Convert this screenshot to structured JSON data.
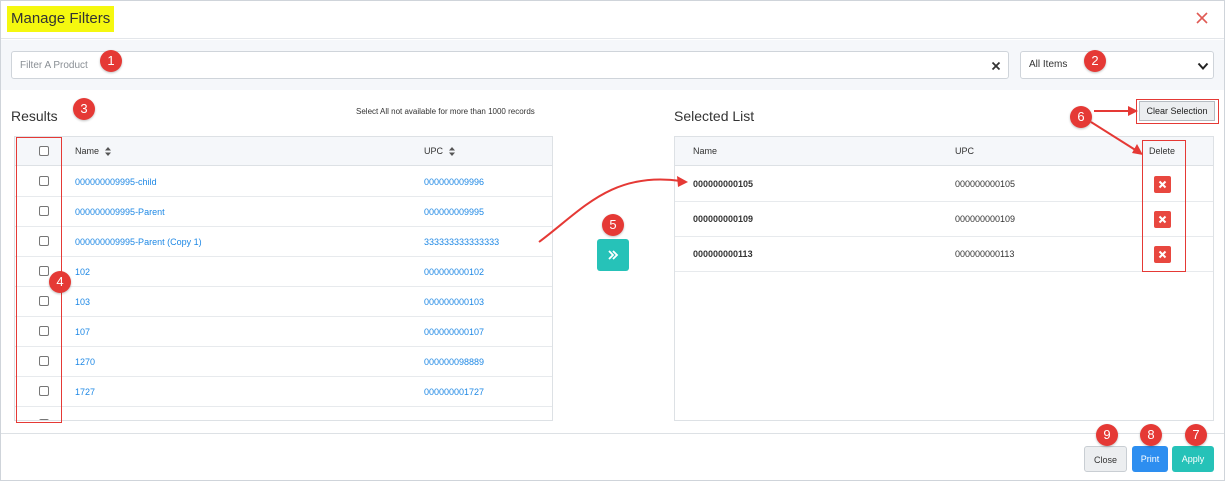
{
  "modal": {
    "title": "Manage Filters"
  },
  "search": {
    "placeholder": "Filter A Product",
    "value": ""
  },
  "filter_select": {
    "selected": "All Items"
  },
  "results": {
    "title": "Results",
    "note": "Select All not available for more than 1000 records",
    "columns": {
      "name": "Name",
      "upc": "UPC"
    },
    "rows": [
      {
        "name": "000000009995-child",
        "upc": "000000009996"
      },
      {
        "name": "000000009995-Parent",
        "upc": "000000009995"
      },
      {
        "name": "000000009995-Parent (Copy 1)",
        "upc": "333333333333333"
      },
      {
        "name": "102",
        "upc": "000000000102"
      },
      {
        "name": "103",
        "upc": "000000000103"
      },
      {
        "name": "107",
        "upc": "000000000107"
      },
      {
        "name": "1270",
        "upc": "000000098889"
      },
      {
        "name": "1727",
        "upc": "000000001727"
      }
    ]
  },
  "selected": {
    "title": "Selected List",
    "clear_label": "Clear Selection",
    "columns": {
      "name": "Name",
      "upc": "UPC",
      "delete": "Delete"
    },
    "rows": [
      {
        "name": "000000000105",
        "upc": "000000000105"
      },
      {
        "name": "000000000109",
        "upc": "000000000109"
      },
      {
        "name": "000000000113",
        "upc": "000000000113"
      }
    ]
  },
  "footer": {
    "close_label": "Close",
    "print_label": "Print",
    "apply_label": "Apply"
  },
  "callouts": [
    "1",
    "2",
    "3",
    "4",
    "5",
    "6",
    "7",
    "8",
    "9"
  ],
  "colors": {
    "accent_teal": "#26c2b8",
    "print_blue": "#2d8ef0",
    "delete_red": "#e8473f",
    "callout_red": "#e53935",
    "title_highlight": "#f5f80f",
    "link_blue": "#1e88e5"
  },
  "icons": {
    "close": "close-icon",
    "clear": "clear-icon",
    "dropdown": "chevron-down-icon",
    "sort": "sort-icon",
    "transfer": "double-chevron-right-icon",
    "delete": "delete-icon"
  }
}
